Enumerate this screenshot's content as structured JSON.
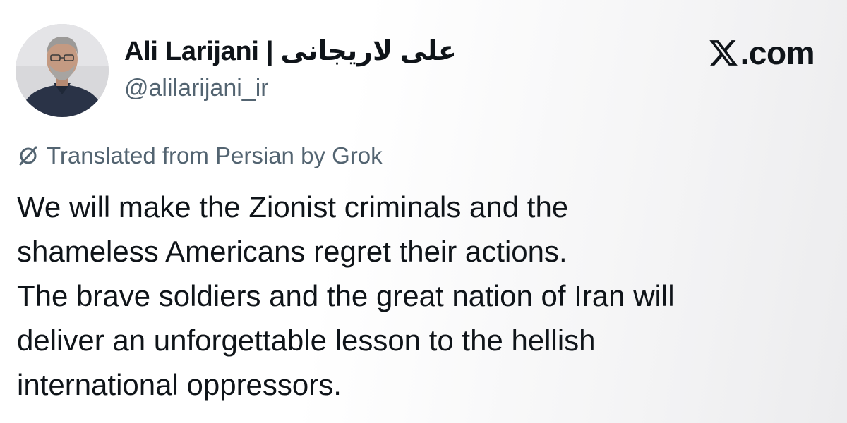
{
  "author": {
    "name": "Ali Larijani | علی لاریجانی",
    "handle": "@alilarijani_ir",
    "avatar_icon": "portrait-avatar"
  },
  "brand": {
    "logo_icon": "x-logo-icon",
    "suffix": ".com"
  },
  "translation": {
    "icon": "translate-icon",
    "label": "Translated from Persian by Grok"
  },
  "tweet": {
    "lines": [
      "We will make the Zionist criminals and the",
      "shameless Americans regret their actions.",
      "The brave soldiers and the great nation of Iran will",
      "deliver an unforgettable lesson to the hellish",
      "international oppressors."
    ]
  },
  "colors": {
    "text": "#0f1419",
    "secondary_text": "#536471",
    "background": "#ffffff"
  }
}
